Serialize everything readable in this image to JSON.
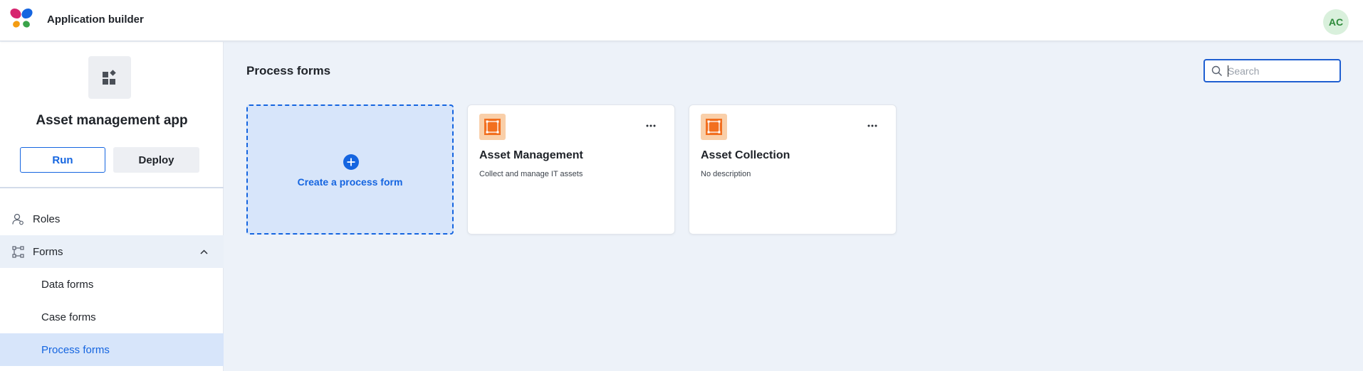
{
  "header": {
    "title": "Application builder",
    "user_initials": "AC",
    "logo_icon": "butterfly-logo",
    "avatar_bg": "#d9f0dc",
    "avatar_fg": "#2e8a3a"
  },
  "sidebar": {
    "app_icon": "widgets-icon",
    "app_name": "Asset management app",
    "run_label": "Run",
    "deploy_label": "Deploy",
    "nav": [
      {
        "label": "Roles",
        "icon": "roles-icon"
      },
      {
        "label": "Forms",
        "icon": "forms-icon",
        "expanded": true
      }
    ],
    "sub_items": [
      {
        "label": "Data forms"
      },
      {
        "label": "Case forms"
      },
      {
        "label": "Process forms",
        "selected": true
      }
    ]
  },
  "main": {
    "title": "Process forms",
    "search": {
      "placeholder": "Search",
      "value": ""
    },
    "create_card": {
      "label": "Create a process form",
      "icon": "plus-circle-icon"
    },
    "cards": [
      {
        "title": "Asset Management",
        "description": "Collect and manage IT assets",
        "icon": "process-form-icon"
      },
      {
        "title": "Asset Collection",
        "description": "No description",
        "icon": "process-form-icon"
      }
    ]
  },
  "colors": {
    "accent": "#1565e0",
    "selected_bg": "#d7e5fa",
    "page_bg": "#edf2f9",
    "form_icon_bg": "#f9cfa9",
    "form_icon_fg": "#f26f1f"
  }
}
